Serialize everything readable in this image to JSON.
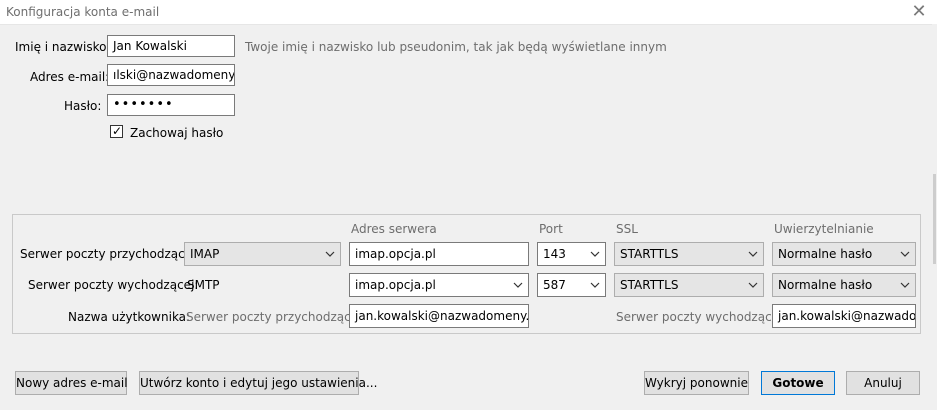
{
  "window": {
    "title": "Konfiguracja konta e-mail",
    "close_glyph": "✕"
  },
  "identity": {
    "name_label": "Imię i nazwisko:",
    "name_value": "Jan Kowalski",
    "name_hint": "Twoje imię i nazwisko lub pseudonim, tak jak będą wyświetlane innym",
    "email_label": "Adres e-mail:",
    "email_value": "ılski@nazwadomeny.pl",
    "password_label": "Hasło:",
    "password_value": "•••••••",
    "remember_label": "Zachowaj hasło",
    "remember_checked": true
  },
  "servers": {
    "headers": {
      "address": "Adres serwera",
      "port": "Port",
      "ssl": "SSL",
      "auth": "Uwierzytelnianie"
    },
    "incoming": {
      "label": "Serwer poczty przychodzącej:",
      "protocol": "IMAP",
      "host": "imap.opcja.pl",
      "port": "143",
      "ssl": "STARTTLS",
      "auth": "Normalne hasło"
    },
    "outgoing": {
      "label": "Serwer poczty wychodzącej:",
      "protocol": "SMTP",
      "host": "imap.opcja.pl",
      "port": "587",
      "ssl": "STARTTLS",
      "auth": "Normalne hasło"
    },
    "username": {
      "label": "Nazwa użytkownika:",
      "incoming_label": "Serwer poczty przychodzącej:",
      "incoming_value": "jan.kowalski@nazwadomeny.pl",
      "outgoing_label": "Serwer poczty wychodzącej:",
      "outgoing_value": "jan.kowalski@nazwadomeny.pl"
    }
  },
  "buttons": {
    "new_address": "Nowy adres e-mail",
    "create_edit": "Utwórz konto i edytuj jego ustawienia...",
    "redetect": "Wykryj ponownie",
    "done": "Gotowe",
    "cancel": "Anuluj"
  },
  "icons": {
    "dropdown": "chevron-down-icon",
    "check": "checkmark-icon",
    "close": "close-icon"
  }
}
